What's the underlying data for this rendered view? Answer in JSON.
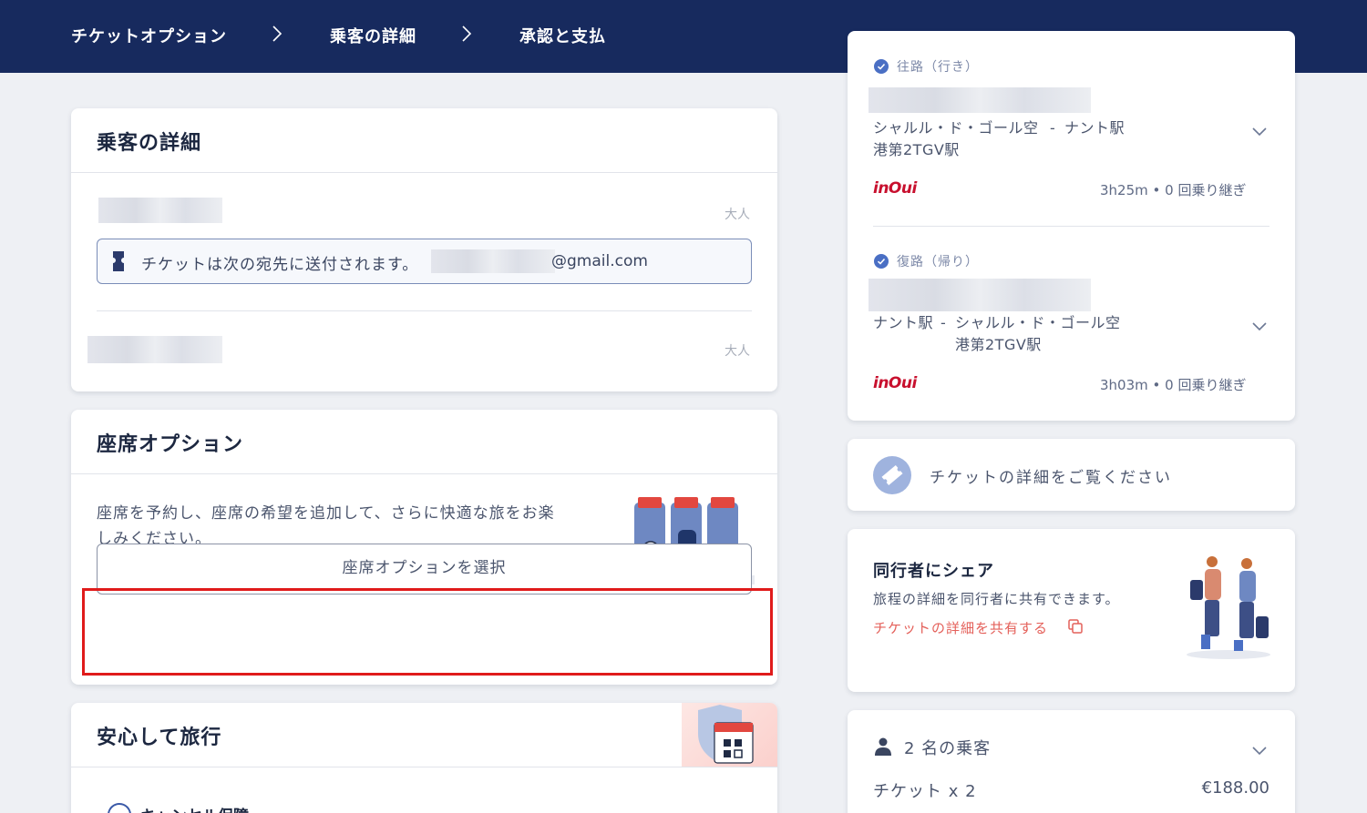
{
  "breadcrumb": {
    "step1": "チケットオプション",
    "step2": "乗客の詳細",
    "step3": "承認と支払"
  },
  "passengers": {
    "title": "乗客の詳細",
    "passenger1_type": "大人",
    "ticket_notice": "チケットは次の宛先に送付されます。",
    "email_suffix": "@gmail.com",
    "passenger2_type": "大人"
  },
  "seats": {
    "title": "座席オプション",
    "description": "座席を予約し、座席の希望を追加して、さらに快適な旅をお楽しみください。",
    "button_label": "座席オプションを選択"
  },
  "insurance": {
    "title": "安心して旅行",
    "option_label": "キャンセル保障"
  },
  "outbound": {
    "label": "往路（行き）",
    "from": "シャルル・ド・ゴール空港第2TGV駅",
    "separator": "-",
    "to": "ナント駅",
    "brand": "inOui",
    "duration": "3h25m • 0 回乗り継ぎ"
  },
  "return": {
    "label": "復路（帰り）",
    "from": "ナント駅",
    "separator": "-",
    "to": "シャルル・ド・ゴール空港第2TGV駅",
    "brand": "inOui",
    "duration": "3h03m • 0 回乗り継ぎ"
  },
  "ticket_details": {
    "label": "チケットの詳細をご覧ください"
  },
  "share": {
    "title": "同行者にシェア",
    "description": "旅程の詳細を同行者に共有できます。",
    "link": "チケットの詳細を共有する"
  },
  "summary": {
    "passengers": "2 名の乗客",
    "ticket_label": "チケット x 2",
    "ticket_price": "€188.00"
  },
  "colors": {
    "header_bg": "#172a5e",
    "accent_red": "#e01b1b",
    "link_coral": "#e4605a",
    "inoui_red": "#c8102e"
  }
}
